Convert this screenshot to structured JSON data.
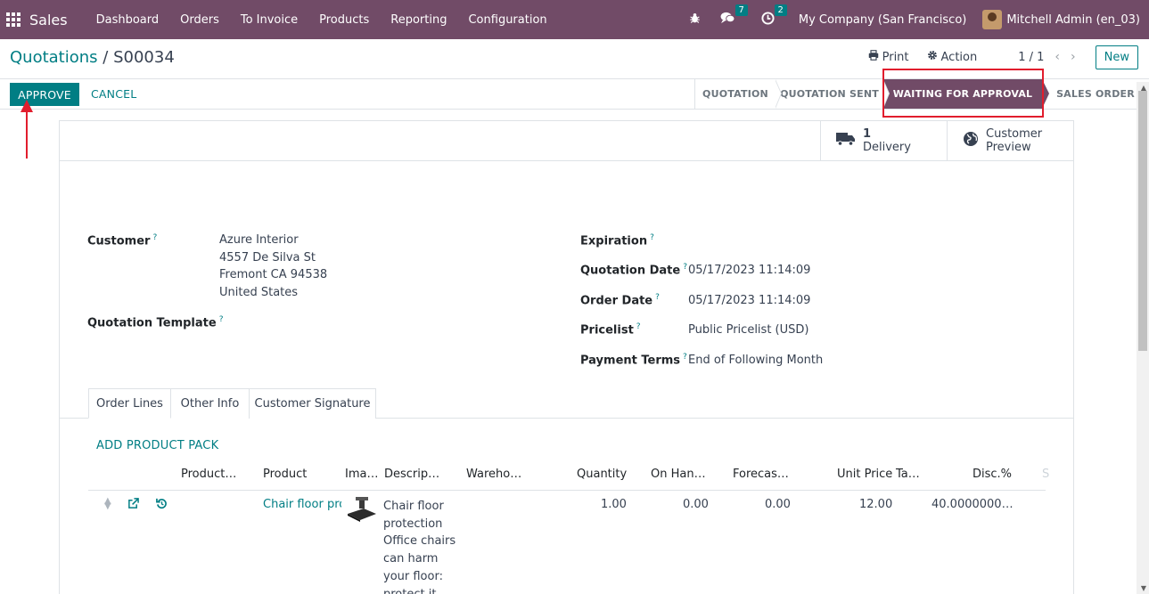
{
  "navbar": {
    "app_name": "Sales",
    "menu": [
      "Dashboard",
      "Orders",
      "To Invoice",
      "Products",
      "Reporting",
      "Configuration"
    ],
    "messages_count": "7",
    "activities_count": "2",
    "company": "My Company (San Francisco)",
    "user": "Mitchell Admin (en_03)",
    "bg_color": "#714b67"
  },
  "breadcrumb": {
    "parent": "Quotations",
    "separator": "/",
    "current": "S00034"
  },
  "control": {
    "print_label": "Print",
    "action_label": "Action",
    "pager": "1 / 1",
    "new_label": "New"
  },
  "statusbar": {
    "approve_label": "APPROVE",
    "cancel_label": "CANCEL",
    "stages": [
      "QUOTATION",
      "QUOTATION SENT",
      "WAITING FOR APPROVAL",
      "SALES ORDER"
    ],
    "active_stage": "WAITING FOR APPROVAL"
  },
  "smart_buttons": {
    "delivery_count": "1",
    "delivery_label": "Delivery",
    "preview_line1": "Customer",
    "preview_line2": "Preview"
  },
  "form": {
    "customer_label": "Customer",
    "customer_name": "Azure Interior",
    "address_line1": "4557 De Silva St",
    "address_line2": "Fremont CA 94538",
    "address_line3": "United States",
    "template_label": "Quotation Template",
    "expiration_label": "Expiration",
    "quotation_date_label": "Quotation Date",
    "quotation_date": "05/17/2023 11:14:09",
    "order_date_label": "Order Date",
    "order_date": "05/17/2023 11:14:09",
    "pricelist_label": "Pricelist",
    "pricelist": "Public Pricelist (USD)",
    "payment_terms_label": "Payment Terms",
    "payment_terms": "End of Following Month",
    "help_mark": "?"
  },
  "tabs": [
    "Order Lines",
    "Other Info",
    "Customer Signature"
  ],
  "order_lines": {
    "add_pack_label": "ADD PRODUCT PACK",
    "headers": [
      "Product…",
      "Product",
      "Ima…",
      "Descrip…",
      "Wareho…",
      "Quantity",
      "On Han…",
      "Forecas…",
      "Unit Price",
      "Ta…",
      "Disc.%",
      "S"
    ],
    "rows": [
      {
        "product": "Chair floor prot",
        "description": "Chair floor protection Office chairs can harm your floor: protect it.",
        "quantity": "1.00",
        "on_hand": "0.00",
        "forecast": "0.00",
        "unit_price": "12.00",
        "discount": "40.0000000…"
      }
    ]
  },
  "accent_color": "#017e84",
  "annotation_color": "#e11d2d"
}
